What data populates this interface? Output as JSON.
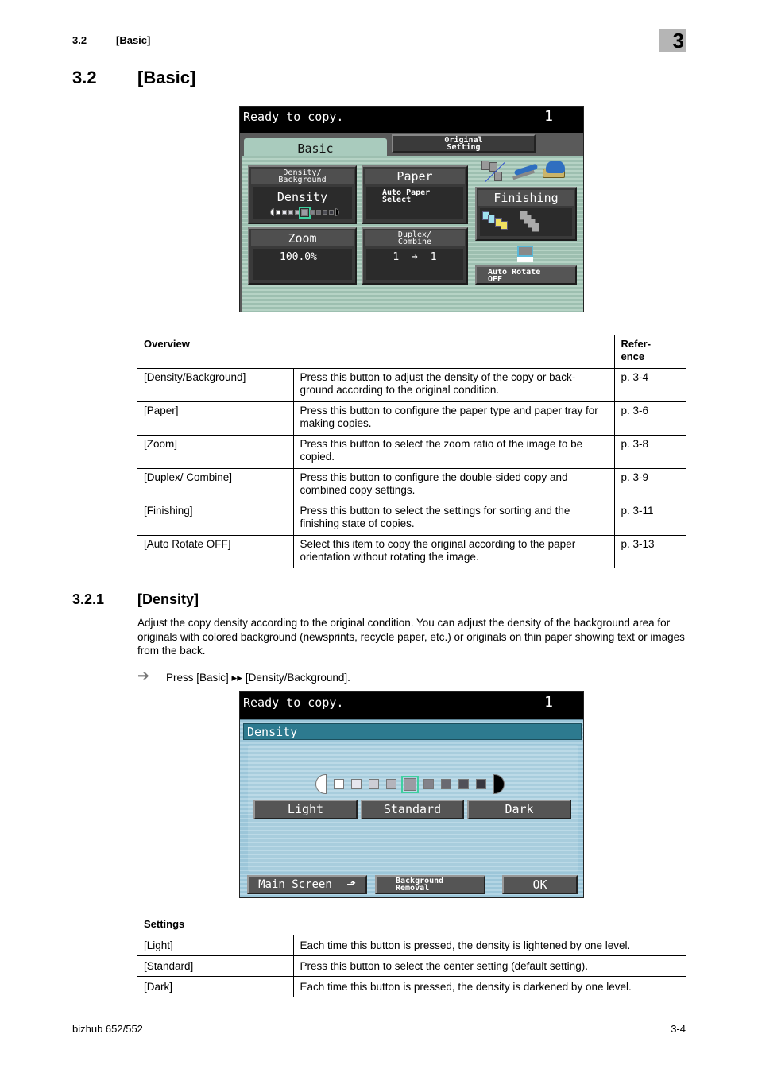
{
  "header": {
    "section_number": "3.2",
    "section_title": "[Basic]",
    "chapter_number": "3"
  },
  "heading": {
    "number": "3.2",
    "title": "[Basic]"
  },
  "basic_screen": {
    "status_message": "Ready to copy.",
    "copy_count": "1",
    "tabs": [
      {
        "label": "Basic",
        "active": true
      },
      {
        "label_line1": "Original",
        "label_line2": "Setting",
        "active": false
      }
    ],
    "density_button": {
      "caption_line1": "Density/",
      "caption_line2": "Background",
      "value": "Density",
      "level": 5,
      "levels": 9
    },
    "paper_button": {
      "caption": "Paper",
      "value_line1": "Auto Paper",
      "value_line2": "Select"
    },
    "zoom_button": {
      "caption": "Zoom",
      "value": "100.0%"
    },
    "duplex_button": {
      "caption_line1": "Duplex/",
      "caption_line2": "Combine",
      "value_from": "1",
      "value_to": "1"
    },
    "finishing_button": {
      "caption": "Finishing"
    },
    "auto_rotate_button": {
      "label_line1": "Auto Rotate",
      "label_line2": "OFF"
    },
    "icons": [
      "sort-icon",
      "staple-icon",
      "punch-icon",
      "finishing-sort-icon",
      "finishing-group-icon",
      "auto-rotate-icon"
    ]
  },
  "overview_table": {
    "headers": [
      "Overview",
      "Refer-\nence"
    ],
    "header_ref_line1": "Refer-",
    "header_ref_line2": "ence",
    "rows": [
      {
        "item": "[Density/Background]",
        "description": "Press this button to adjust the density of the copy or back-ground according to the original condition.",
        "reference": "p. 3-4"
      },
      {
        "item": "[Paper]",
        "description": "Press this button to configure the paper type and paper tray for making copies.",
        "reference": "p. 3-6"
      },
      {
        "item": "[Zoom]",
        "description": "Press this button to select the zoom ratio of the image to be copied.",
        "reference": "p. 3-8"
      },
      {
        "item": "[Duplex/ Combine]",
        "description": "Press this button to configure the double-sided copy and combined copy settings.",
        "reference": "p. 3-9"
      },
      {
        "item": "[Finishing]",
        "description": "Press this button to select the settings for sorting and the finishing state of copies.",
        "reference": "p. 3-11"
      },
      {
        "item": "[Auto Rotate OFF]",
        "description": "Select this item to copy the original according to the paper orientation without rotating the image.",
        "reference": "p. 3-13"
      }
    ]
  },
  "subsection": {
    "number": "3.2.1",
    "title": "[Density]",
    "paragraph": "Adjust the copy density according to the original condition. You can adjust the density of the background area for originals with colored background (newsprints, recycle paper, etc.) or originals on thin paper showing text or images from the back.",
    "step_arrow": "➔",
    "step_text": "Press [Basic] ▸▸ [Density/Background]."
  },
  "density_screen": {
    "status_message": "Ready to copy.",
    "copy_count": "1",
    "title": "Density",
    "level": 5,
    "levels": 9,
    "buttons": {
      "light": "Light",
      "standard": "Standard",
      "dark": "Dark"
    },
    "footer_buttons": {
      "main_screen": "Main Screen",
      "background_line1": "Background",
      "background_line2": "Removal",
      "ok": "OK"
    }
  },
  "settings_table": {
    "caption": "Settings",
    "rows": [
      {
        "item": "[Light]",
        "description": "Each time this button is pressed, the density is lightened by one level."
      },
      {
        "item": "[Standard]",
        "description": "Press this button to select the center setting (default setting)."
      },
      {
        "item": "[Dark]",
        "description": "Each time this button is pressed, the density is darkened by one level."
      }
    ]
  },
  "footer": {
    "product": "bizhub 652/552",
    "page": "3-4"
  }
}
